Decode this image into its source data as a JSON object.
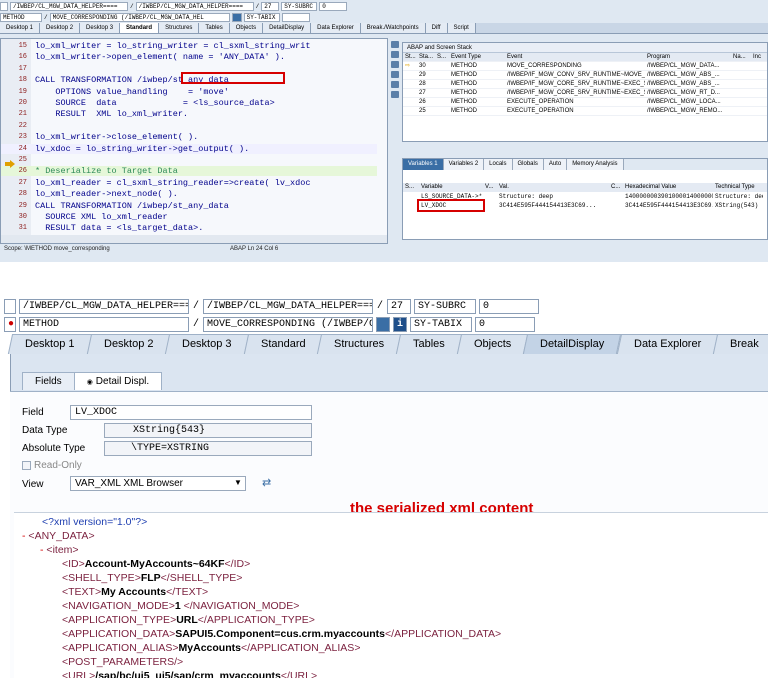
{
  "top": {
    "row1": {
      "path1": "/IWBEP/CL_MGW_DATA_HELPER====",
      "path2": "/IWBEP/CL_MGW_DATA_HELPER====",
      "line": "27",
      "sysvar": "SY-SUBRC",
      "sysval": "0"
    },
    "row2": {
      "kind": "METHOD",
      "method": "MOVE_CORRESPONDING (/IWBEP/CL_MGW_DATA_HEL",
      "sysvar": "SY-TABIX"
    },
    "tabs": [
      "Desktop 1",
      "Desktop 2",
      "Desktop 3",
      "Standard",
      "Structures",
      "Tables",
      "Objects",
      "DetailDisplay",
      "Data Explorer",
      "Break./Watchpoints",
      "Diff",
      "Script"
    ],
    "active_tab": "Standard",
    "code": [
      {
        "n": "15",
        "t": "lo_xml_writer = lo_string_writer = cl_sxml_string_writ"
      },
      {
        "n": "16",
        "t": "lo_xml_writer->open_element( name = 'ANY_DATA' )."
      },
      {
        "n": "17",
        "t": ""
      },
      {
        "n": "18",
        "t": "CALL TRANSFORMATION /iwbep/st_any_data"
      },
      {
        "n": "19",
        "t": "    OPTIONS value_handling    = 'move'"
      },
      {
        "n": "20",
        "t": "    SOURCE  data             = <ls_source_data>"
      },
      {
        "n": "21",
        "t": "    RESULT  XML lo_xml_writer."
      },
      {
        "n": "22",
        "t": ""
      },
      {
        "n": "23",
        "t": "lo_xml_writer->close_element( )."
      },
      {
        "n": "24",
        "t": "lv_xdoc = lo_string_writer->get_output( )."
      },
      {
        "n": "25",
        "t": ""
      },
      {
        "n": "26",
        "t": "* Deserialize to Target Data"
      },
      {
        "n": "27",
        "t": "lo_xml_reader = cl_sxml_string_reader=>create( lv_xdoc"
      },
      {
        "n": "28",
        "t": "lo_xml_reader->next_node( )."
      },
      {
        "n": "29",
        "t": "CALL TRANSFORMATION /iwbep/st_any_data"
      },
      {
        "n": "30",
        "t": "  SOURCE XML lo_xml_reader"
      },
      {
        "n": "31",
        "t": "  RESULT data = <ls_target_data>."
      }
    ],
    "scope": "Scope: \\METHOD move_corresponding",
    "status": "ABAP    Ln  24 Col  6",
    "stack": {
      "title": "ABAP and Screen Stack",
      "headers": [
        "St...",
        "Sta...",
        "S...",
        "Event Type",
        "Event",
        "Program",
        "Na...",
        "Inc"
      ],
      "rows": [
        {
          "n": "30",
          "type": "METHOD",
          "event": "MOVE_CORRESPONDING",
          "prog": "/IWBEP/CL_MGW_DATA..."
        },
        {
          "n": "29",
          "type": "METHOD",
          "event": "/IWBEP/IF_MGW_CONV_SRV_RUNTIME~MOVE_CORR...",
          "prog": "/IWBEP/CL_MGW_ABS_..."
        },
        {
          "n": "28",
          "type": "METHOD",
          "event": "/IWBEP/IF_MGW_CORE_SRV_RUNTIME~EXEC_SERVI...",
          "prog": "/IWBEP/CL_MGW_ABS_..."
        },
        {
          "n": "27",
          "type": "METHOD",
          "event": "/IWBEP/IF_MGW_CORE_SRV_RUNTIME~EXEC_SERVI...",
          "prog": "/IWBEP/CL_MGW_RT_D..."
        },
        {
          "n": "26",
          "type": "METHOD",
          "event": "EXECUTE_OPERATION",
          "prog": "/IWBEP/CL_MGW_LOCA..."
        },
        {
          "n": "25",
          "type": "METHOD",
          "event": "EXECUTE_OPERATION",
          "prog": "/IWBEP/CL_MGW_REMO..."
        }
      ]
    },
    "vars": {
      "tabs": [
        "Variables 1",
        "Variables 2",
        "Locals",
        "Globals",
        "Auto",
        "Memory Analysis"
      ],
      "headers": [
        "S...",
        "Variable",
        "V...",
        "Val.",
        "C...",
        "Hexadecimal Value",
        "Technical Type"
      ],
      "rows": [
        {
          "var": "LS_SOURCE_DATA->*[1]",
          "val": "Structure: deep",
          "hex": "14000000039010000140000000...",
          "tech": "Structure: deep"
        },
        {
          "var": "LV_XDOC",
          "val": "3C414E595F444154413E3C69...",
          "hex": "3C414E595F444154413E3C69...",
          "tech": "XString(543)"
        }
      ]
    }
  },
  "bottom": {
    "row1": {
      "path1": "/IWBEP/CL_MGW_DATA_HELPER====",
      "path2": "/IWBEP/CL_MGW_DATA_HELPER====",
      "line": "27",
      "sysvar": "SY-SUBRC",
      "sysval": "0"
    },
    "row2": {
      "kind": "METHOD",
      "method": "MOVE_CORRESPONDING (/IWBEP/CL_MGW_DATA_HEL.",
      "sysvar": "SY-TABIX",
      "sysval": "0"
    },
    "tabs": [
      "Desktop 1",
      "Desktop 2",
      "Desktop 3",
      "Standard",
      "Structures",
      "Tables",
      "Objects",
      "DetailDisplay",
      "Data Explorer",
      "Break"
    ],
    "active_tab": "DetailDisplay",
    "subtabs": [
      "Fields",
      "Detail Displ."
    ],
    "field_label": "Field",
    "field_value": "LV_XDOC",
    "data_type_label": "Data Type",
    "data_type_value": "XString{543}",
    "abs_type_label": "Absolute Type",
    "abs_type_value": "\\TYPE=XSTRING",
    "readonly_label": "Read-Only",
    "view_label": "View",
    "view_value": "VAR_XML XML Browser",
    "annotation": "the serialized xml content",
    "xml": {
      "decl": "<?xml version=\"1.0\"?>",
      "root": "ANY_DATA",
      "item": "item",
      "fields": [
        {
          "tag": "ID",
          "value": "Account-MyAccounts~64KF"
        },
        {
          "tag": "SHELL_TYPE",
          "value": "FLP"
        },
        {
          "tag": "TEXT",
          "value": "My Accounts"
        },
        {
          "tag": "NAVIGATION_MODE",
          "value": "1 "
        },
        {
          "tag": "APPLICATION_TYPE",
          "value": "URL"
        },
        {
          "tag": "APPLICATION_DATA",
          "value": "SAPUI5.Component=cus.crm.myaccounts"
        },
        {
          "tag": "APPLICATION_ALIAS",
          "value": "MyAccounts"
        },
        {
          "tag": "POST_PARAMETERS",
          "value": "",
          "selfclose": true
        },
        {
          "tag": "URL",
          "value": "/sap/bc/ui5_ui5/sap/crm_myaccounts"
        }
      ]
    }
  },
  "colors": {
    "highlight_red": "#d60000",
    "tab_bg": "#d9e3ef",
    "panel_bg": "#dbe5f1"
  }
}
